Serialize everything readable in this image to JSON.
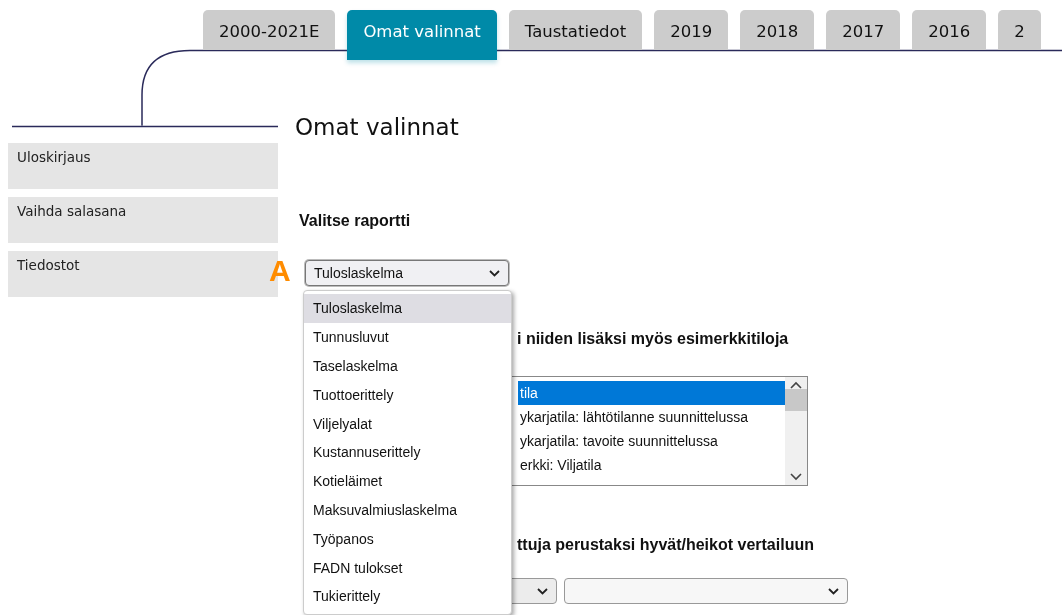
{
  "tabs": [
    {
      "label": "2000-2021E",
      "selected": false
    },
    {
      "label": "Omat valinnat",
      "selected": true
    },
    {
      "label": "Taustatiedot",
      "selected": false
    },
    {
      "label": "2019",
      "selected": false
    },
    {
      "label": "2018",
      "selected": false
    },
    {
      "label": "2017",
      "selected": false
    },
    {
      "label": "2016",
      "selected": false
    },
    {
      "label": "2",
      "selected": false
    }
  ],
  "sidebar": {
    "items": [
      "Uloskirjaus",
      "Vaihda salasana",
      "Tiedostot"
    ]
  },
  "page_title": "Omat valinnat",
  "report_section": {
    "heading": "Valitse raportti",
    "marker": "A",
    "select": {
      "value": "Tuloslaskelma",
      "open": true
    },
    "options": [
      {
        "label": "Tuloslaskelma",
        "selected": true
      },
      {
        "label": "Tunnusluvut",
        "selected": false
      },
      {
        "label": "Taselaskelma",
        "selected": false
      },
      {
        "label": "Tuottoerittely",
        "selected": false
      },
      {
        "label": "Viljelyalat",
        "selected": false
      },
      {
        "label": "Kustannuserittely",
        "selected": false
      },
      {
        "label": "Kotieläimet",
        "selected": false
      },
      {
        "label": "Maksuvalmiuslaskelma",
        "selected": false
      },
      {
        "label": "Työpanos",
        "selected": false
      },
      {
        "label": "FADN tulokset",
        "selected": false
      },
      {
        "label": "Tukierittely",
        "selected": false
      }
    ]
  },
  "farms_section": {
    "heading": "i niiden lisäksi myös esimerkkitiloja",
    "list": [
      {
        "label": "tila",
        "selected": true
      },
      {
        "label": "ykarjatila: lähtötilanne suunnittelussa",
        "selected": false
      },
      {
        "label": "ykarjatila: tavoite suunnittelussa",
        "selected": false
      },
      {
        "label": "erkki: Viljatila",
        "selected": false
      }
    ]
  },
  "compare_section": {
    "heading": "ttuja perustaksi hyvät/heikot vertailuun"
  }
}
